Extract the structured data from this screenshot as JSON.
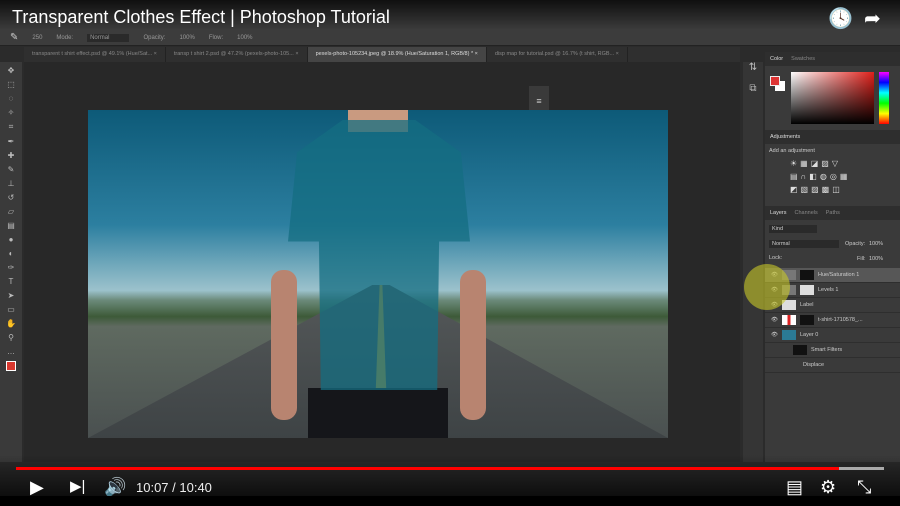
{
  "video": {
    "title": "Transparent Clothes Effect | Photoshop Tutorial",
    "current_time": "10:07",
    "duration": "10:40",
    "time_display": "10:07 / 10:40",
    "progress_fraction": 0.948,
    "accent": "#ff0000"
  },
  "options": {
    "size": "250",
    "mode_label": "Mode:",
    "mode": "Normal",
    "opacity_label": "Opacity:",
    "opacity": "100%",
    "flow_label": "Flow:",
    "flow": "100%"
  },
  "tabs": [
    {
      "label": "transparent t shirt effect.psd @ 49.1% (Hue/Sat...",
      "active": false
    },
    {
      "label": "transp t shirt 2.psd @ 47.2% (pexels-photo-105...",
      "active": false
    },
    {
      "label": "pexels-photo-105234.jpeg @ 18.9% (Hue/Saturation 1, RGB/8) *",
      "active": true
    },
    {
      "label": "disp map for tutorial.psd @ 16.7% (t shirt, RGB...",
      "active": false
    }
  ],
  "panels": {
    "color_tabs": [
      "Color",
      "Swatches"
    ],
    "adjustments_title": "Adjustments",
    "add_adjustment": "Add an adjustment",
    "layers_tabs": [
      "Layers",
      "Channels",
      "Paths"
    ],
    "kind": "Kind",
    "blend": "Normal",
    "opacity_label": "Opacity:",
    "opacity": "100%",
    "lock_label": "Lock:",
    "fill_label": "Fill:",
    "fill": "100%",
    "foreground": "#d9382f",
    "background": "#ffffff",
    "layers": [
      {
        "name": "Hue/Saturation 1",
        "selected": true
      },
      {
        "name": "Levels 1",
        "selected": false
      },
      {
        "name": "Label",
        "selected": false
      },
      {
        "name": "t-shirt-1710578_...",
        "selected": false
      },
      {
        "name": "Layer 0",
        "selected": false
      },
      {
        "name": "Smart Filters",
        "selected": false
      },
      {
        "name": "Displace",
        "selected": false
      }
    ]
  }
}
